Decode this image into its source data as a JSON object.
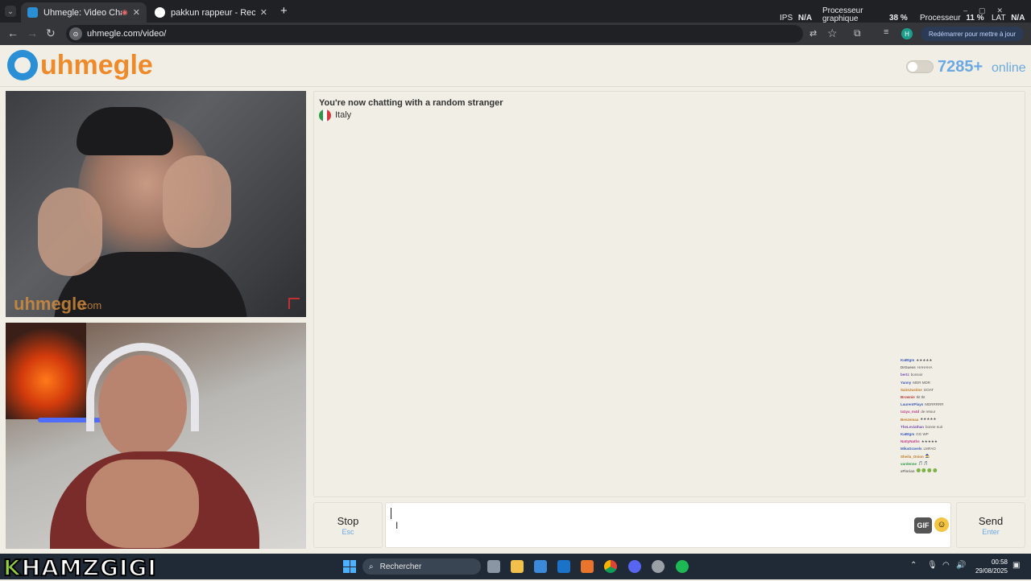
{
  "browser": {
    "tabs": [
      {
        "title": "Uhmegle: Video Chat | Omegle",
        "active": true
      },
      {
        "title": "pakkun rappeur - Recherche Google",
        "active": false
      }
    ],
    "new_tab": "+",
    "url": "uhmegle.com/video/",
    "perf": {
      "ips_label": "IPS",
      "ips_value": "N/A",
      "gpu_label": "Processeur graphique",
      "gpu_value": "38 %",
      "cpu_label": "Processeur",
      "cpu_value": "11 %",
      "lat_label": "LAT",
      "lat_value": "N/A"
    },
    "profile_initial": "H",
    "restart_label": "Redémarrer pour mettre à jour"
  },
  "site": {
    "logo_text": "uhmegle",
    "online_count": "7285+",
    "online_label": "online",
    "watermark": "uhmegle",
    "watermark_suffix": ".com"
  },
  "chat": {
    "status": "You're now chatting with a random stranger",
    "country": "Italy",
    "flag_colors": [
      "#2e9a47",
      "#ffffff",
      "#d63a3a"
    ]
  },
  "controls": {
    "stop_label": "Stop",
    "stop_hint": "Esc",
    "send_label": "Send",
    "send_hint": "Enter",
    "gif_label": "GIF",
    "message_value": ""
  },
  "overlay_feed": [
    {
      "user": "KaBtgm",
      "msg": "★★★★★",
      "color": "#3b5bb8"
    },
    {
      "user": "DrGuess",
      "msg": "HAHAHA",
      "color": "#6a6a6a"
    },
    {
      "user": "bertz",
      "msg": "bonsoir",
      "color": "#7a4fb1"
    },
    {
      "user": "Yanny",
      "msg": "MDR MDR",
      "color": "#3b5bb8"
    },
    {
      "user": "SaintJustine",
      "msg": "GOAT",
      "color": "#c07a25"
    },
    {
      "user": "Brownie",
      "msg": "tkt tkt",
      "color": "#b63a3a"
    },
    {
      "user": "LaurentPlays",
      "msg": "MDRRRRR",
      "color": "#3b5bb8"
    },
    {
      "user": "ta1ya_m4d",
      "msg": "de retour",
      "color": "#c03a8c"
    },
    {
      "user": "Benzemaa",
      "msg": "★★★★★",
      "color": "#c07a25"
    },
    {
      "user": "TheLeviathan",
      "msg": "bonne nuit",
      "color": "#7a4fb1"
    },
    {
      "user": "KaBtgm",
      "msg": "GG WP",
      "color": "#3b5bb8"
    },
    {
      "user": "NattyNaths",
      "msg": "★★★★★",
      "color": "#c03a8c"
    },
    {
      "user": "MikaGravels",
      "msg": "LMFAO",
      "color": "#3b5bb8"
    },
    {
      "user": "Sheila_Onion",
      "msg": "🧙",
      "color": "#c07a25"
    },
    {
      "user": "vardenne",
      "msg": "🎵 🎵",
      "color": "#2e9a47"
    },
    {
      "user": "xFlorian",
      "msg": "🟢 🟢 🟢 🟢",
      "color": "#6a6a6a"
    }
  ],
  "taskbar": {
    "streamer_name": "KHAMZGIGI",
    "search_placeholder": "Rechercher",
    "time": "00:58",
    "date": "29/08/2025"
  }
}
